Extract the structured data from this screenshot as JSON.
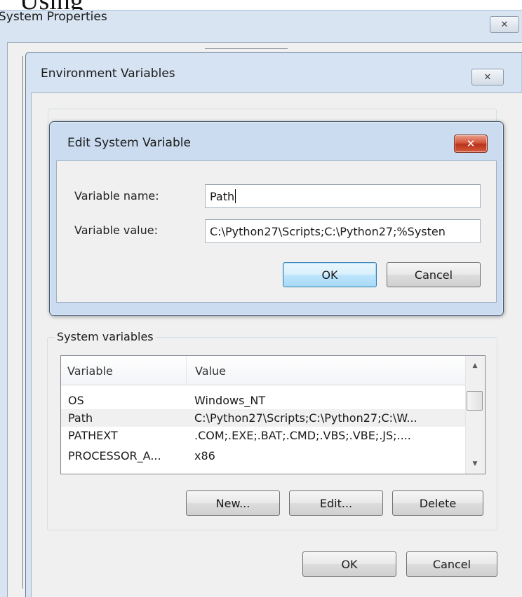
{
  "top_text": "Using",
  "system_properties": {
    "title": "System Properties",
    "close_glyph": "✕"
  },
  "environment_variables": {
    "title": "Environment Variables",
    "close_glyph": "✕",
    "system_variables": {
      "group_label": "System variables",
      "columns": [
        "Variable",
        "Value"
      ],
      "rows": [
        {
          "variable": "OS",
          "value": "Windows_NT"
        },
        {
          "variable": "Path",
          "value": "C:\\Python27\\Scripts;C:\\Python27;C:\\W..."
        },
        {
          "variable": "PATHEXT",
          "value": ".COM;.EXE;.BAT;.CMD;.VBS;.VBE;.JS;...."
        },
        {
          "variable": "PROCESSOR_A...",
          "value": "x86"
        }
      ],
      "selected_row": 1,
      "buttons": {
        "new": "New...",
        "edit": "Edit...",
        "delete": "Delete"
      }
    },
    "buttons": {
      "ok": "OK",
      "cancel": "Cancel"
    }
  },
  "edit_dialog": {
    "title": "Edit System Variable",
    "close_glyph": "✕",
    "variable_name_label": "Variable name:",
    "variable_name_value": "Path",
    "variable_value_label": "Variable value:",
    "variable_value_value": "C:\\Python27\\Scripts;C:\\Python27;%Systen",
    "buttons": {
      "ok": "OK",
      "cancel": "Cancel"
    }
  },
  "icons": {
    "scroll_up": "▲",
    "scroll_down": "▼"
  },
  "colors": {
    "title_bar": "#d8e4f2",
    "dialog_frame": "#cbdcf0",
    "close_button_red": "#c8452a",
    "default_button_border": "#3c7fb1",
    "window_body": "#f0f0f0"
  }
}
